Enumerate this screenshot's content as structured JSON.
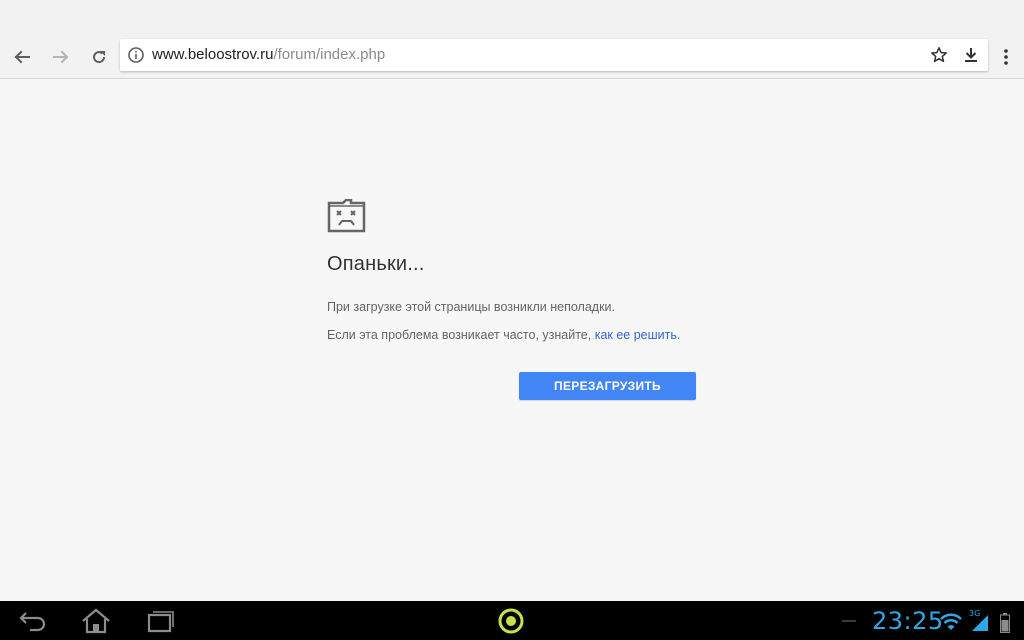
{
  "browser": {
    "url_host": "www.beloostrov.ru",
    "url_path": "/forum/index.php"
  },
  "error": {
    "title": "Опаньки...",
    "line1": "При загрузке этой страницы возникли неполадки.",
    "line2_prefix": "Если эта проблема возникает часто, узнайте, ",
    "line2_link": "как ее решить",
    "line2_suffix": ".",
    "reload_label": "ПЕРЕЗАГРУЗИТЬ"
  },
  "system_bar": {
    "time": "23:25",
    "network": "3G"
  },
  "colors": {
    "button_blue": "#4285f4",
    "link_blue": "#3366cc",
    "clock_blue": "#2fa8e6"
  }
}
